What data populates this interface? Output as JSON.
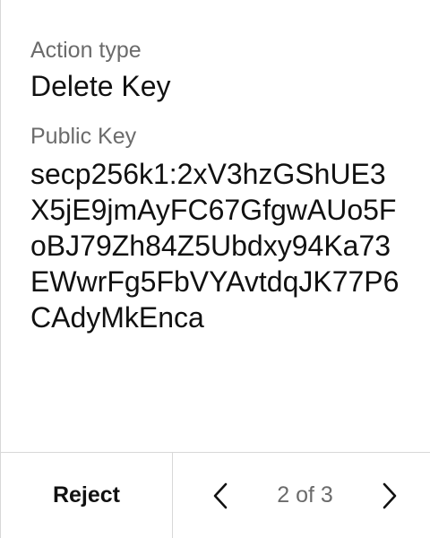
{
  "action": {
    "type_label": "Action type",
    "type_value": "Delete Key"
  },
  "public_key": {
    "label": "Public Key",
    "value": "secp256k1:2xV3hzGShUE3X5jE9jmAyFC67GfgwAUo5FoBJ79Zh84Z5Ubdxy94Ka73EWwrFg5FbVYAvtdqJK77P6CAdyMkEnca"
  },
  "footer": {
    "reject_label": "Reject",
    "page_indicator": "2 of 3",
    "prev_icon": "chevron-left-icon",
    "next_icon": "chevron-right-icon"
  },
  "colors": {
    "text_primary": "#111111",
    "text_secondary": "#6b6b6b",
    "border": "#d8d8d8",
    "background": "#ffffff"
  }
}
